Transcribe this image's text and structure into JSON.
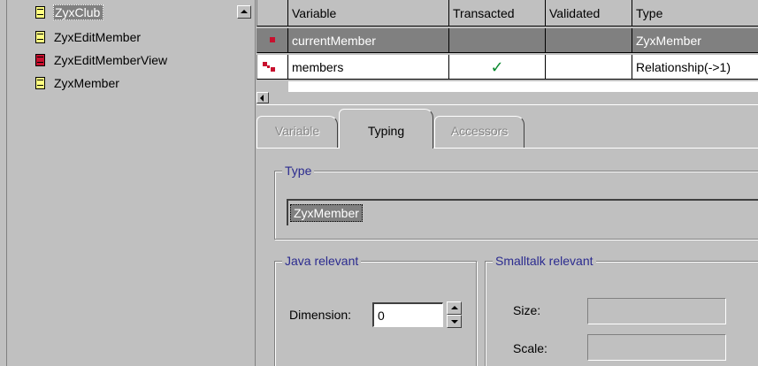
{
  "class_list": {
    "items": [
      {
        "label": "ZyxClub",
        "icon": "class-icon-yellow",
        "selected": true
      },
      {
        "label": "ZyxEditMember",
        "icon": "class-icon-yellow",
        "selected": false
      },
      {
        "label": "ZyxEditMemberView",
        "icon": "class-icon-red",
        "selected": false
      },
      {
        "label": "ZyxMember",
        "icon": "class-icon-yellow",
        "selected": false
      }
    ]
  },
  "variable_table": {
    "headers": {
      "variable": "Variable",
      "transacted": "Transacted",
      "validated": "Validated",
      "type": "Type"
    },
    "rows": [
      {
        "variable": "currentMember",
        "transacted": "",
        "validated": "",
        "type": "ZyxMember",
        "icon": "attribute-icon",
        "selected": true
      },
      {
        "variable": "members",
        "transacted": "✓",
        "validated": "",
        "type": "Relationship(->1)",
        "icon": "relationship-icon",
        "selected": false
      }
    ]
  },
  "tabs": [
    {
      "label": "Variable",
      "state": "disabled"
    },
    {
      "label": "Typing",
      "state": "active"
    },
    {
      "label": "Accessors",
      "state": "disabled"
    }
  ],
  "typing": {
    "type_group_title": "Type",
    "type_value": "ZyxMember",
    "java_group_title": "Java relevant",
    "dimension_label": "Dimension:",
    "dimension_value": "0",
    "smalltalk_group_title": "Smalltalk relevant",
    "size_label": "Size:",
    "size_value": "",
    "scale_label": "Scale:",
    "scale_value": ""
  },
  "colors": {
    "window_bg": "#c0c0c0",
    "selection_bg": "#808080",
    "group_title": "#2b2b8f",
    "class_icon_yellow": "#ffff80",
    "class_icon_red": "#c8102e",
    "check_green": "#0a8a30"
  }
}
